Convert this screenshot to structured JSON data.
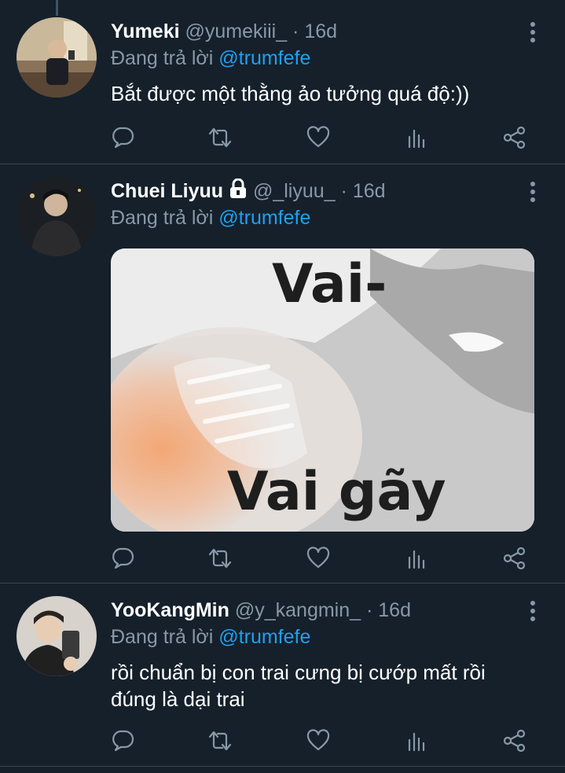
{
  "tweets": [
    {
      "name": "Yumeki",
      "handle": "@yumekiii_",
      "separator": "·",
      "time": "16d",
      "reply_prefix": "Đang trả lời",
      "reply_to": "@trumfefe",
      "text": "Bắt được một thằng ảo tưởng quá độ:))"
    },
    {
      "name": "Chuei Liyuu",
      "protected_icon": "lock-icon",
      "handle": "@_liyuu_",
      "separator": "·",
      "time": "16d",
      "reply_prefix": "Đang trả lời",
      "reply_to": "@trumfefe",
      "media": {
        "top_text": "Vai-",
        "bottom_text": "Vai gãy"
      }
    },
    {
      "name": "YooKangMin",
      "handle": "@y_kangmin_",
      "separator": "·",
      "time": "16d",
      "reply_prefix": "Đang trả lời",
      "reply_to": "@trumfefe",
      "text_lines": [
        "rồi chuẩn bị con trai cưng bị cướp mất rồi",
        "đúng là dại trai"
      ]
    }
  ],
  "action_icons": [
    "reply-icon",
    "retweet-icon",
    "like-icon",
    "analytics-icon",
    "share-icon"
  ],
  "colors": {
    "background": "#15202b",
    "secondary_text": "#8899a6",
    "accent": "#1da1f2",
    "divider": "#38444d"
  }
}
